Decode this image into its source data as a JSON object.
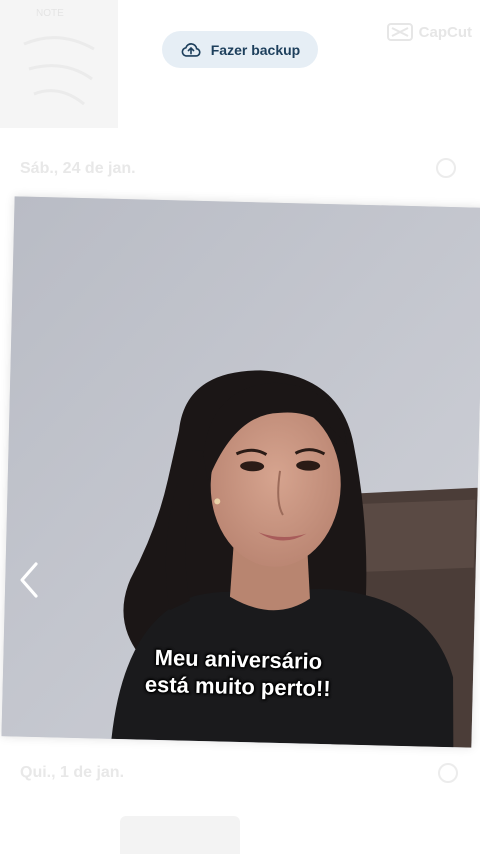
{
  "toolbar": {
    "backup_label": "Fazer backup",
    "backup_icon": "cloud-upload-icon"
  },
  "watermark": {
    "text": "CapCut",
    "icon": "capcut-logo-icon"
  },
  "gallery": {
    "thumb_caption": "NOTE",
    "date_top": "Sáb., 24 de jan.",
    "date_bottom": "Qui., 1 de jan."
  },
  "photo": {
    "caption_line1": "Meu aniversário",
    "caption_line2": "está muito perto!!"
  },
  "navigation": {
    "prev_icon": "chevron-left-icon"
  },
  "colors": {
    "pill_bg": "#e6eef5",
    "pill_text": "#1d3f5c",
    "wall": "#bfc2cb",
    "caption_text": "#ffffff"
  }
}
